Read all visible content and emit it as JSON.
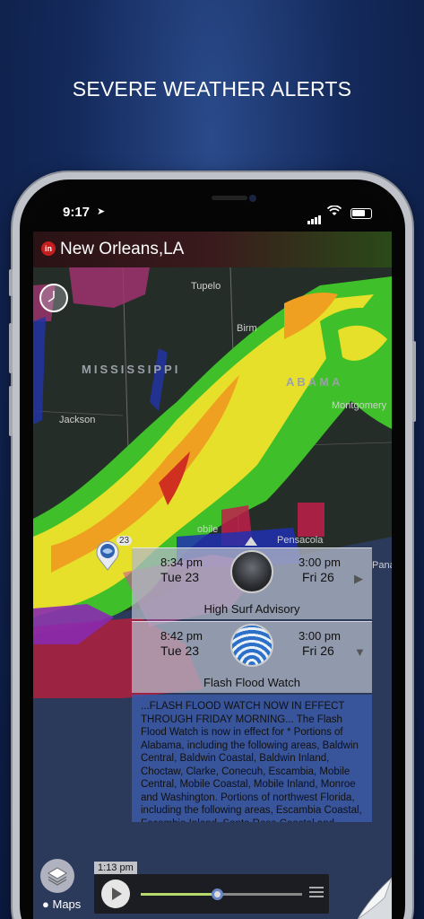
{
  "promo": {
    "headline": "SEVERE WEATHER ALERTS"
  },
  "status_bar": {
    "time": "9:17"
  },
  "header": {
    "location": "New Orleans,LA",
    "logo_letter": "in"
  },
  "map": {
    "labels": {
      "tupelo": "Tupelo",
      "birmingham": "Birm",
      "mississippi": "MISSISSIPPI",
      "alabama": "ABAMA",
      "jackson": "Jackson",
      "montgomery": "Montgomery",
      "mobile": "obile",
      "pensacola": "Pensacola",
      "pana": "Pana"
    },
    "pin_count": "23"
  },
  "alerts": [
    {
      "start_time": "8:34 pm",
      "start_date": "Tue 23",
      "end_time": "3:00 pm",
      "end_date": "Fri 26",
      "title": "High Surf Advisory",
      "icon": "surf-icon"
    },
    {
      "start_time": "8:42 pm",
      "start_date": "Tue 23",
      "end_time": "3:00 pm",
      "end_date": "Fri 26",
      "title": "Flash Flood Watch",
      "icon": "flood-icon"
    }
  ],
  "alert_detail": "...FLASH FLOOD WATCH NOW IN EFFECT THROUGH FRIDAY MORNING... The Flash Flood Watch is now in effect for\n* Portions of Alabama, including the following areas, Baldwin Central, Baldwin Coastal, Baldwin Inland, Choctaw, Clarke, Conecuh, Escambia, Mobile Central, Mobile Coastal, Mobile Inland, Monroe and Washington. Portions of northwest Florida, including the following areas, Escambia Coastal, Escambia Inland, Santa Rosa Coastal and Santa Rosa Inland. Portions of southeast",
  "player": {
    "timestamp": "1:13 pm",
    "progress": 0.47
  },
  "credits": {
    "maps": "Maps"
  },
  "colors": {
    "header_dark": "#2a1215",
    "accent": "#b5d96a",
    "alert_blue": "#3c5aaa"
  }
}
